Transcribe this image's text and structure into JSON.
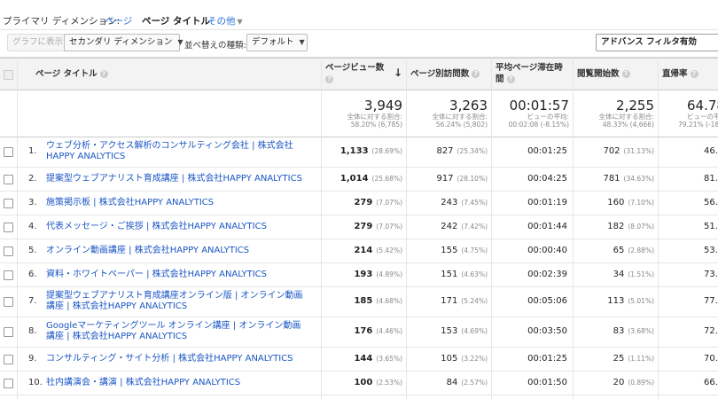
{
  "dimension": {
    "label": "プライマリ ディメンション:",
    "options": [
      "ページ",
      "ページ タイトル",
      "その他"
    ],
    "active_index": 1
  },
  "toolbar": {
    "graph_btn": "グラフに表示",
    "secondary_btn": "セカンダリ ディメンション",
    "sort_label": "並べ替えの種類:",
    "sort_btn": "デフォルト",
    "advanced_filter": "アドバンス フィルタ有効"
  },
  "header": {
    "page_title": "ページ タイトル",
    "pageviews": "ページビュー数",
    "unique": "ページ別訪問数",
    "avg_time_l1": "平均ページ滞在時",
    "avg_time_l2": "間",
    "entrances": "閲覧開始数",
    "bounce": "直帰率"
  },
  "totals": {
    "pageviews": {
      "big": "3,949",
      "s1": "全体に対する割合:",
      "s2": "58.20% (6,785)"
    },
    "unique": {
      "big": "3,263",
      "s1": "全体に対する割合:",
      "s2": "56.24% (5,802)"
    },
    "avg_time": {
      "big": "00:01:57",
      "s1": "ビューの平均:",
      "s2": "00:02:08 (-8.15%)"
    },
    "entrances": {
      "big": "2,255",
      "s1": "全体に対する割合:",
      "s2": "48.33% (4,666)"
    },
    "bounce": {
      "big": "64.78",
      "s1": "ビューの平",
      "s2": "79.21% (-18.2"
    }
  },
  "rows": [
    {
      "idx": "1.",
      "t1": "ウェブ分析・アクセス解析のコンサルティング会社 | 株式会社",
      "t2": "HAPPY ANALYTICS",
      "pv": "1,133",
      "pvp": "(28.69%)",
      "uv": "827",
      "uvp": "(25.34%)",
      "time": "00:01:25",
      "en": "702",
      "enp": "(31.13%)",
      "br": "46."
    },
    {
      "idx": "2.",
      "t1": "提案型ウェブアナリスト育成講座 | 株式会社HAPPY ANALYTICS",
      "t2": "",
      "pv": "1,014",
      "pvp": "(25.68%)",
      "uv": "917",
      "uvp": "(28.10%)",
      "time": "00:04:25",
      "en": "781",
      "enp": "(34.63%)",
      "br": "81."
    },
    {
      "idx": "3.",
      "t1": "施策掲示板 | 株式会社HAPPY ANALYTICS",
      "t2": "",
      "pv": "279",
      "pvp": "(7.07%)",
      "uv": "243",
      "uvp": "(7.45%)",
      "time": "00:01:19",
      "en": "160",
      "enp": "(7.10%)",
      "br": "56."
    },
    {
      "idx": "4.",
      "t1": "代表メッセージ・ご挨拶 | 株式会社HAPPY ANALYTICS",
      "t2": "",
      "pv": "279",
      "pvp": "(7.07%)",
      "uv": "242",
      "uvp": "(7.42%)",
      "time": "00:01:44",
      "en": "182",
      "enp": "(8.07%)",
      "br": "51."
    },
    {
      "idx": "5.",
      "t1": "オンライン動画講座 | 株式会社HAPPY ANALYTICS",
      "t2": "",
      "pv": "214",
      "pvp": "(5.42%)",
      "uv": "155",
      "uvp": "(4.75%)",
      "time": "00:00:40",
      "en": "65",
      "enp": "(2.88%)",
      "br": "53."
    },
    {
      "idx": "6.",
      "t1": "資料・ホワイトペーパー | 株式会社HAPPY ANALYTICS",
      "t2": "",
      "pv": "193",
      "pvp": "(4.89%)",
      "uv": "151",
      "uvp": "(4.63%)",
      "time": "00:02:39",
      "en": "34",
      "enp": "(1.51%)",
      "br": "73."
    },
    {
      "idx": "7.",
      "t1": "提案型ウェブアナリスト育成講座オンライン版 | オンライン動画",
      "t2": "講座 | 株式会社HAPPY ANALYTICS",
      "pv": "185",
      "pvp": "(4.68%)",
      "uv": "171",
      "uvp": "(5.24%)",
      "time": "00:05:06",
      "en": "113",
      "enp": "(5.01%)",
      "br": "77."
    },
    {
      "idx": "8.",
      "t1": "Googleマーケティングツール オンライン講座 | オンライン動画",
      "t2": "講座 | 株式会社HAPPY ANALYTICS",
      "pv": "176",
      "pvp": "(4.46%)",
      "uv": "153",
      "uvp": "(4.69%)",
      "time": "00:03:50",
      "en": "83",
      "enp": "(3.68%)",
      "br": "72."
    },
    {
      "idx": "9.",
      "t1": "コンサルティング・サイト分析 | 株式会社HAPPY ANALYTICS",
      "t2": "",
      "pv": "144",
      "pvp": "(3.65%)",
      "uv": "105",
      "uvp": "(3.22%)",
      "time": "00:01:25",
      "en": "25",
      "enp": "(1.11%)",
      "br": "70."
    },
    {
      "idx": "10.",
      "t1": "社内講演会・講演 | 株式会社HAPPY ANALYTICS",
      "t2": "",
      "pv": "100",
      "pvp": "(2.53%)",
      "uv": "84",
      "uvp": "(2.57%)",
      "time": "00:01:50",
      "en": "20",
      "enp": "(0.89%)",
      "br": "66."
    }
  ]
}
